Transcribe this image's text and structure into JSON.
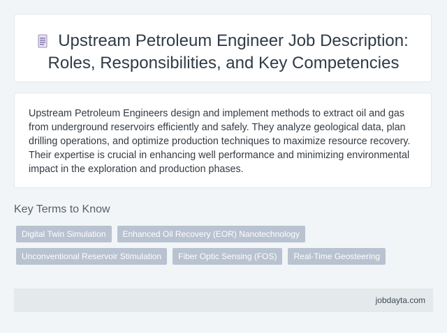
{
  "header": {
    "icon": "document-icon",
    "title_line1": "Upstream Petroleum Engineer Job Description:",
    "title_line2": "Roles, Responsibilities, and Key Competencies"
  },
  "description": {
    "text": "Upstream Petroleum Engineers design and implement methods to extract oil and gas from underground reservoirs efficiently and safely. They analyze geological data, plan drilling operations, and optimize production techniques to maximize resource recovery. Their expertise is crucial in enhancing well performance and minimizing environmental impact in the exploration and production phases."
  },
  "key_terms": {
    "heading": "Key Terms to Know",
    "row1": [
      "Digital Twin Simulation",
      "Enhanced Oil Recovery (EOR) Nanotechnology"
    ],
    "row2": [
      "Unconventional Reservoir Stimulation",
      "Fiber Optic Sensing (FOS)",
      "Real-Time Geosteering"
    ]
  },
  "footer": {
    "site": "jobdayta.com"
  },
  "colors": {
    "background": "#f2f5f7",
    "tag_background": "#b8c2d0",
    "footer_background": "#e4eaec"
  }
}
